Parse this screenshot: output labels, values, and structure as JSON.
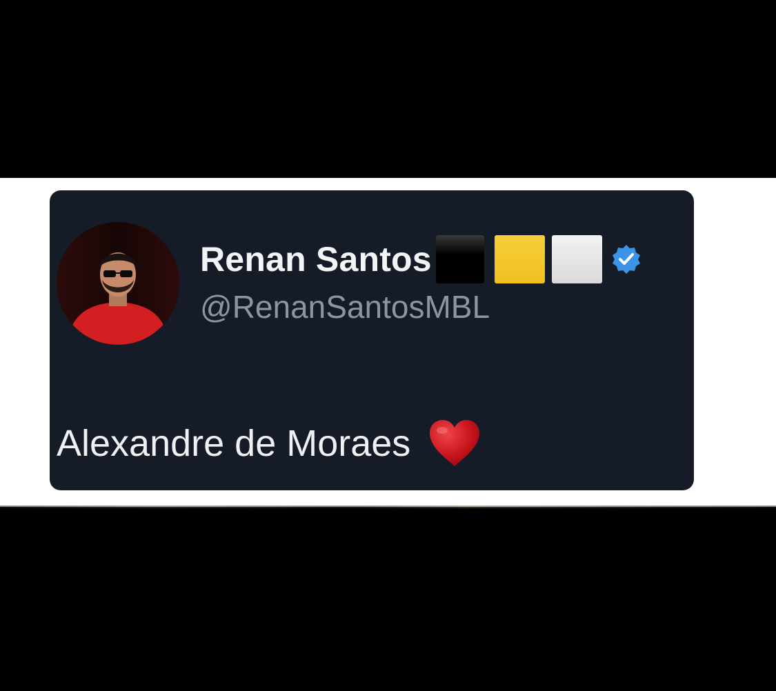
{
  "tweet": {
    "display_name": "Renan Santos",
    "handle": "@RenanSantosMBL",
    "text": "Alexandre de Moraes",
    "flag_emojis": [
      {
        "name": "black-square",
        "color": "#000000"
      },
      {
        "name": "yellow-square",
        "color": "#f0c020"
      },
      {
        "name": "white-square",
        "color": "#e6e6e6"
      }
    ],
    "verified": true,
    "verified_color": "#3b94e6",
    "emoji": "red-heart"
  },
  "colors": {
    "card_background": "#151b27",
    "outer_background": "#000000",
    "band_background": "#ffffff",
    "name_color": "#f3f4f6",
    "handle_color": "#8b95a3",
    "text_color": "#eef0f3"
  }
}
